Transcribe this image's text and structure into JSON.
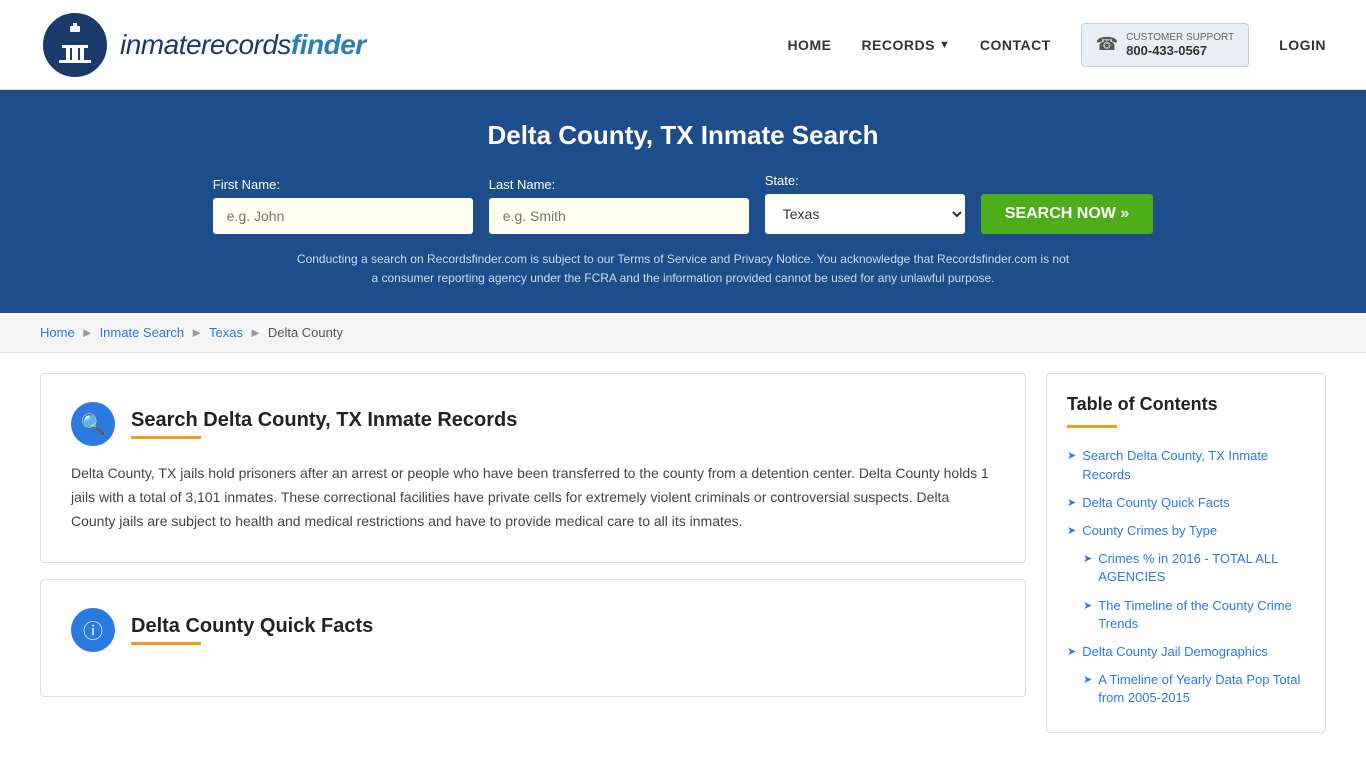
{
  "header": {
    "logo_text_plain": "inmaterecords",
    "logo_text_bold": "finder",
    "nav": {
      "home": "HOME",
      "records": "RECORDS",
      "contact": "CONTACT",
      "customer_support_label": "CUSTOMER SUPPORT",
      "customer_support_number": "800-433-0567",
      "login": "LOGIN"
    }
  },
  "hero": {
    "title": "Delta County, TX Inmate Search",
    "form": {
      "firstname_label": "First Name:",
      "firstname_placeholder": "e.g. John",
      "lastname_label": "Last Name:",
      "lastname_placeholder": "e.g. Smith",
      "state_label": "State:",
      "state_value": "Texas",
      "search_button": "SEARCH NOW »"
    },
    "disclaimer": "Conducting a search on Recordsfinder.com is subject to our Terms of Service and Privacy Notice. You acknowledge that Recordsfinder.com is not a consumer reporting agency under the FCRA and the information provided cannot be used for any unlawful purpose."
  },
  "breadcrumb": {
    "home": "Home",
    "inmate_search": "Inmate Search",
    "texas": "Texas",
    "delta_county": "Delta County"
  },
  "main_section": {
    "title": "Search Delta County, TX Inmate Records",
    "body": "Delta County, TX jails hold prisoners after an arrest or people who have been transferred to the county from a detention center. Delta County holds 1 jails with a total of 3,101 inmates. These correctional facilities have private cells for extremely violent criminals or controversial suspects. Delta County jails are subject to health and medical restrictions and have to provide medical care to all its inmates."
  },
  "quick_facts_section": {
    "title": "Delta County Quick Facts"
  },
  "toc": {
    "title": "Table of Contents",
    "items": [
      {
        "label": "Search Delta County, TX Inmate Records",
        "sub": false
      },
      {
        "label": "Delta County Quick Facts",
        "sub": false
      },
      {
        "label": "County Crimes by Type",
        "sub": false
      },
      {
        "label": "Crimes % in 2016 - TOTAL ALL AGENCIES",
        "sub": true
      },
      {
        "label": "The Timeline of the County Crime Trends",
        "sub": true
      },
      {
        "label": "Delta County Jail Demographics",
        "sub": false
      },
      {
        "label": "A Timeline of Yearly Data Pop Total from 2005-2015",
        "sub": true
      }
    ]
  }
}
